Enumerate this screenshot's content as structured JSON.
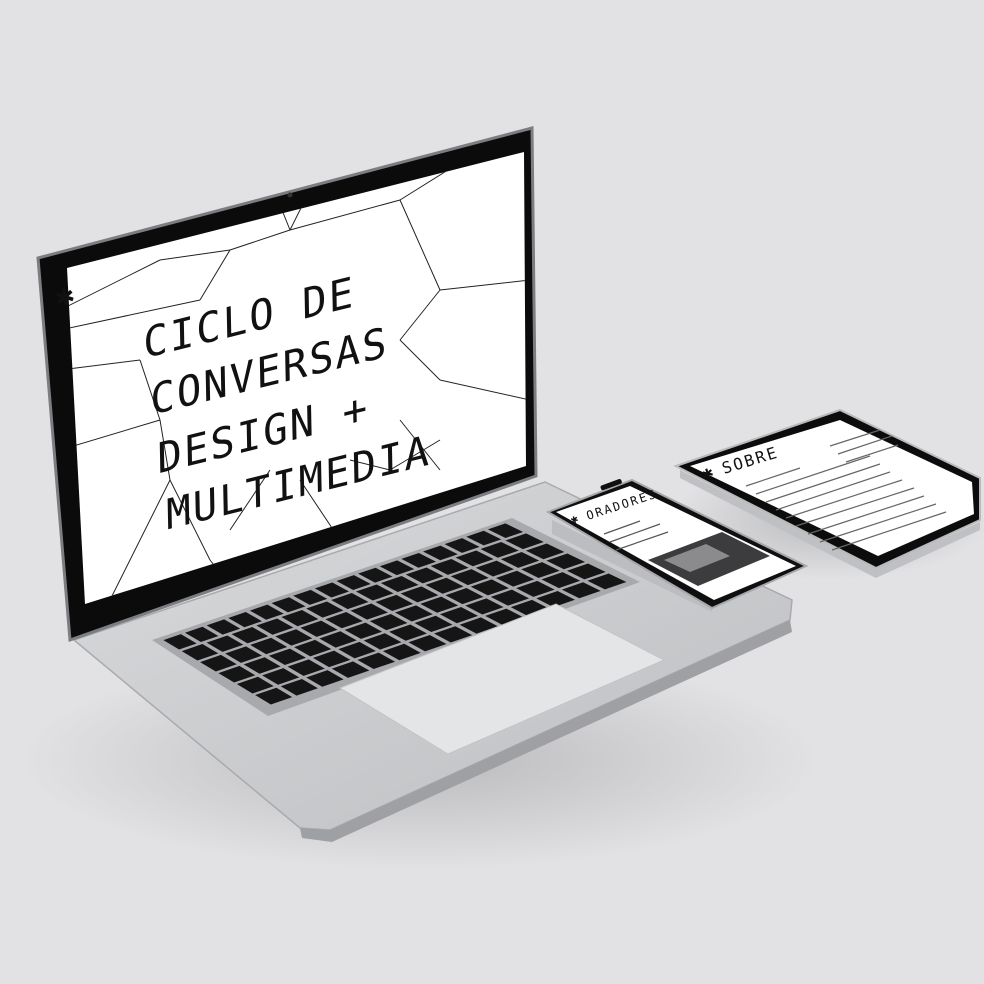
{
  "laptop_screen": {
    "asterisk": "✱",
    "title_lines": [
      "CICLO DE",
      "CONVERSAS",
      "DESIGN +",
      "MULTIMEDIA"
    ]
  },
  "phone_screen": {
    "asterisk": "✱",
    "heading": "ORADORES"
  },
  "tablet_screen": {
    "asterisk": "✱",
    "heading": "SOBRE"
  },
  "colors": {
    "background": "#e2e2e4",
    "device_body": "#cfd0d2",
    "screen_bezel": "#0b0b0c",
    "screen": "#ffffff",
    "ink": "#111111"
  }
}
